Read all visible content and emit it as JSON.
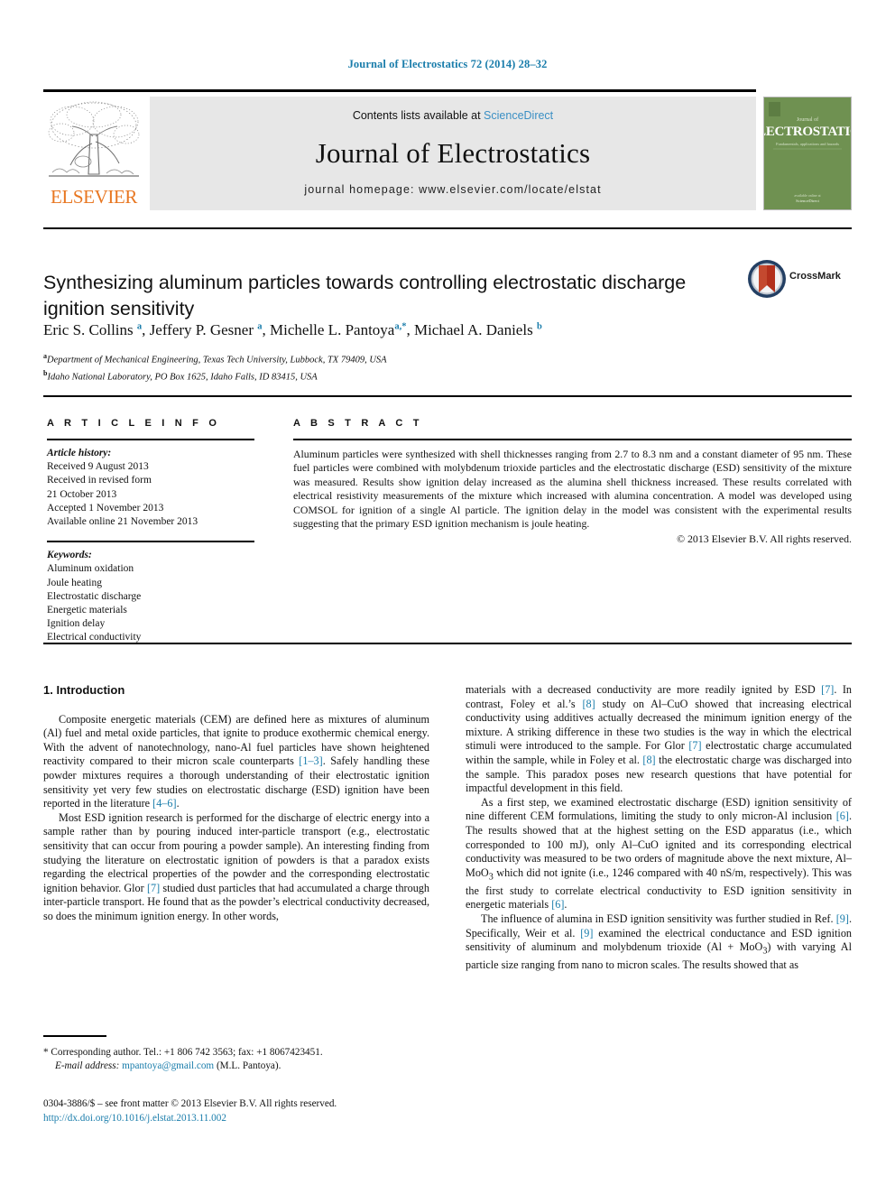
{
  "running_head": "Journal of Electrostatics 72 (2014) 28–32",
  "masthead": {
    "contents_prefix": "Contents lists available at ",
    "sciencedirect": "ScienceDirect",
    "journal_name": "Journal of Electrostatics",
    "homepage": "journal homepage: www.elsevier.com/locate/elstat",
    "publisher_wordmark": "ELSEVIER",
    "cover_title": "ELECTROSTATICS",
    "cover_overline": "Journal of",
    "cover_subtitle": "Fundamentals, applications and hazards",
    "colors": {
      "link_blue": "#3a8fc4",
      "elsevier_orange": "#E87722",
      "cover_green": "#6f9151",
      "masthead_gray": "#e7e7e7"
    }
  },
  "article": {
    "title": "Synthesizing aluminum particles towards controlling electrostatic discharge ignition sensitivity",
    "crossmark_label": "CrossMark",
    "authors_html": "Eric S. Collins <sup>a</sup>, Jeffery P. Gesner <sup>a</sup>, Michelle L. Pantoya<sup>a,*</sup>, Michael A. Daniels <sup>b</sup>",
    "affiliations": [
      "Department of Mechanical Engineering, Texas Tech University, Lubbock, TX 79409, USA",
      "Idaho National Laboratory, PO Box 1625, Idaho Falls, ID 83415, USA"
    ],
    "affiliation_markers": [
      "a",
      "b"
    ]
  },
  "info": {
    "heading": "A R T I C L E   I N F O",
    "history_label": "Article history:",
    "history": [
      "Received 9 August 2013",
      "Received in revised form",
      "21 October 2013",
      "Accepted 1 November 2013",
      "Available online 21 November 2013"
    ],
    "keywords_label": "Keywords:",
    "keywords": [
      "Aluminum oxidation",
      "Joule heating",
      "Electrostatic discharge",
      "Energetic materials",
      "Ignition delay",
      "Electrical conductivity"
    ]
  },
  "abstract": {
    "heading": "A B S T R A C T",
    "text": "Aluminum particles were synthesized with shell thicknesses ranging from 2.7 to 8.3 nm and a constant diameter of 95 nm. These fuel particles were combined with molybdenum trioxide particles and the electrostatic discharge (ESD) sensitivity of the mixture was measured. Results show ignition delay increased as the alumina shell thickness increased. These results correlated with electrical resistivity measurements of the mixture which increased with alumina concentration. A model was developed using COMSOL for ignition of a single Al particle. The ignition delay in the model was consistent with the experimental results suggesting that the primary ESD ignition mechanism is joule heating.",
    "rights": "© 2013 Elsevier B.V. All rights reserved."
  },
  "body": {
    "section_number_title": "1. Introduction",
    "left_paragraphs": [
      "Composite energetic materials (CEM) are defined here as mixtures of aluminum (Al) fuel and metal oxide particles, that ignite to produce exothermic chemical energy. With the advent of nanotechnology, nano-Al fuel particles have shown heightened reactivity compared to their micron scale counterparts [1–3]. Safely handling these powder mixtures requires a thorough understanding of their electrostatic ignition sensitivity yet very few studies on electrostatic discharge (ESD) ignition have been reported in the literature [4–6].",
      "Most ESD ignition research is performed for the discharge of electric energy into a sample rather than by pouring induced inter-particle transport (e.g., electrostatic sensitivity that can occur from pouring a powder sample). An interesting finding from studying the literature on electrostatic ignition of powders is that a paradox exists regarding the electrical properties of the powder and the corresponding electrostatic ignition behavior. Glor [7] studied dust particles that had accumulated a charge through inter-particle transport. He found that as the powder's electrical conductivity decreased, so does the minimum ignition energy. In other words,"
    ],
    "right_paragraphs": [
      "materials with a decreased conductivity are more readily ignited by ESD [7]. In contrast, Foley et al.'s [8] study on Al–CuO showed that increasing electrical conductivity using additives actually decreased the minimum ignition energy of the mixture. A striking difference in these two studies is the way in which the electrical stimuli were introduced to the sample. For Glor [7] electrostatic charge accumulated within the sample, while in Foley et al. [8] the electrostatic charge was discharged into the sample. This paradox poses new research questions that have potential for impactful development in this field.",
      "As a first step, we examined electrostatic discharge (ESD) ignition sensitivity of nine different CEM formulations, limiting the study to only micron-Al inclusion [6]. The results showed that at the highest setting on the ESD apparatus (i.e., which corresponded to 100 mJ), only Al–CuO ignited and its corresponding electrical conductivity was measured to be two orders of magnitude above the next mixture, Al–MoO3 which did not ignite (i.e., 1246 compared with 40 nS/m, respectively). This was the first study to correlate electrical conductivity to ESD ignition sensitivity in energetic materials [6].",
      "The influence of alumina in ESD ignition sensitivity was further studied in Ref. [9]. Specifically, Weir et al. [9] examined the electrical conductance and ESD ignition sensitivity of aluminum and molybdenum trioxide (Al + MoO3) with varying Al particle size ranging from nano to micron scales. The results showed that as"
    ],
    "reference_color": "#1a7dab"
  },
  "footnotes": {
    "corresponding": "* Corresponding author. Tel.: +1 806 742 3563; fax: +1 8067423451.",
    "email_label": "E-mail address:",
    "email": "mpantoya@gmail.com",
    "email_suffix": "(M.L. Pantoya).",
    "issn_line": "0304-3886/$ – see front matter © 2013 Elsevier B.V. All rights reserved.",
    "doi": "http://dx.doi.org/10.1016/j.elstat.2013.11.002"
  }
}
